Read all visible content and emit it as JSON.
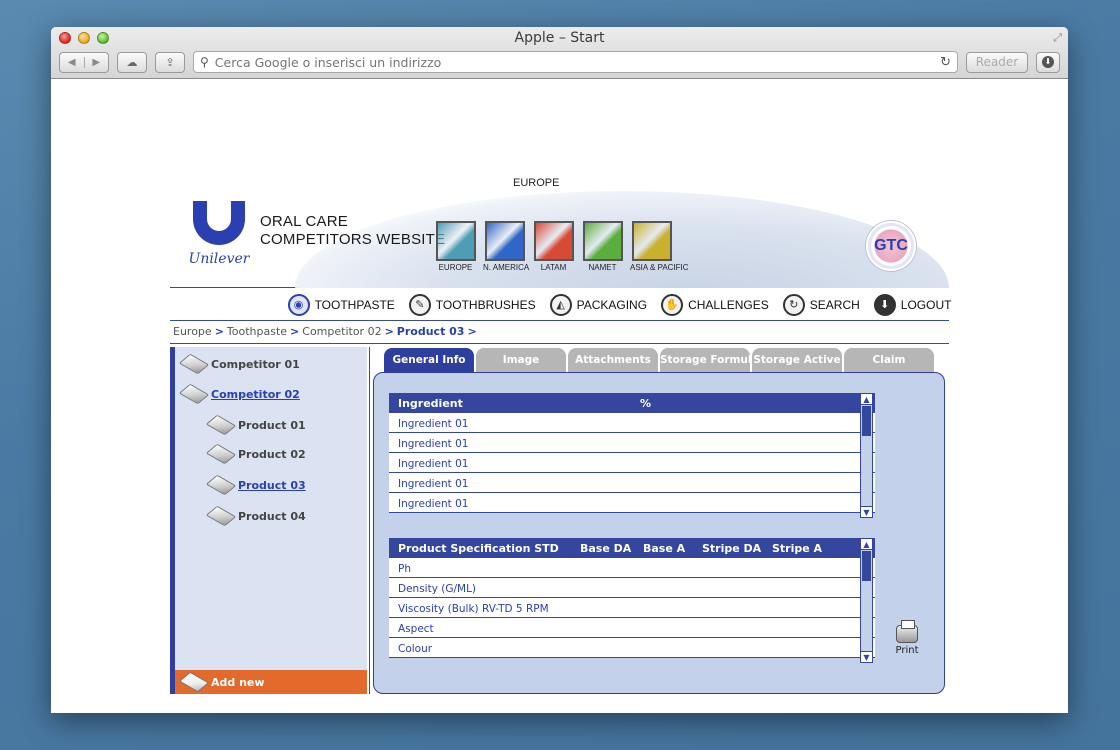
{
  "browser": {
    "title": "Apple – Start",
    "url_placeholder": "Cerca Google o inserisci un indirizzo",
    "reader_label": "Reader",
    "icons": {
      "back": "◀",
      "forward": "▶",
      "cloud": "☁",
      "share": "⇪",
      "search": "⚲",
      "reload": "↻",
      "download": "⬇",
      "fullscreen": "⤢"
    }
  },
  "header": {
    "region_title": "EUROPE",
    "logo_text": "Unilever",
    "site_title_line1": "ORAL CARE",
    "site_title_line2": "COMPETITORS WEBSITE",
    "regions": [
      {
        "label": "EUROPE",
        "color": "#4e9cb5"
      },
      {
        "label": "N. AMERICA",
        "color": "#2f66c8"
      },
      {
        "label": "LATAM",
        "color": "#d84a35"
      },
      {
        "label": "NAMET",
        "color": "#5cae3c"
      },
      {
        "label": "ASIA & PACIFIC",
        "color": "#c9b12e"
      }
    ],
    "badge_text": "GTC"
  },
  "nav": {
    "items": [
      {
        "label": "TOOTHPASTE",
        "icon": "◉"
      },
      {
        "label": "TOOTHBRUSHES",
        "icon": "✎"
      },
      {
        "label": "PACKAGING",
        "icon": "◭"
      },
      {
        "label": "CHALLENGES",
        "icon": "✋"
      },
      {
        "label": "SEARCH",
        "icon": "↻"
      },
      {
        "label": "LOGOUT",
        "icon": "⬇"
      }
    ]
  },
  "breadcrumb": {
    "items": [
      "Europe",
      "Toothpaste",
      "Competitor 02"
    ],
    "current": "Product 03",
    "separator": ">"
  },
  "sidebar": {
    "items": [
      {
        "label": "Competitor 01",
        "level": 0,
        "selected": false
      },
      {
        "label": "Competitor 02",
        "level": 0,
        "selected": true
      },
      {
        "label": "Product 01",
        "level": 1,
        "selected": false
      },
      {
        "label": "Product 02",
        "level": 1,
        "selected": false
      },
      {
        "label": "Product 03",
        "level": 1,
        "selected": true
      },
      {
        "label": "Product 04",
        "level": 1,
        "selected": false
      }
    ],
    "add_new_label": "Add new"
  },
  "tabs": [
    {
      "label": "General Info",
      "active": true
    },
    {
      "label": "Image",
      "active": false
    },
    {
      "label": "Attachments",
      "active": false
    },
    {
      "label": "Storage Formula",
      "active": false
    },
    {
      "label": "Storage Active",
      "active": false
    },
    {
      "label": "Claim",
      "active": false
    }
  ],
  "ingredients_table": {
    "columns": [
      "Ingredient",
      "%"
    ],
    "rows": [
      "Ingredient 01",
      "Ingredient 01",
      "Ingredient 01",
      "Ingredient 01",
      "Ingredient 01"
    ]
  },
  "spec_table": {
    "columns": [
      "Product Specification STD",
      "Base DA",
      "Base A",
      "Stripe DA",
      "Stripe A"
    ],
    "rows": [
      "Ph",
      "Density (G/ML)",
      "Viscosity (Bulk) RV-TD 5 RPM",
      "Aspect",
      "Colour"
    ]
  },
  "scroll": {
    "up": "▲",
    "down": "▼"
  },
  "print_label": "Print",
  "colors": {
    "brand_blue": "#2f3f9e",
    "accent_orange": "#e36a2b",
    "panel_bg": "#c3d1eb",
    "sidebar_bg": "#dbe3f2",
    "tab_inactive": "#b6b6b6"
  }
}
